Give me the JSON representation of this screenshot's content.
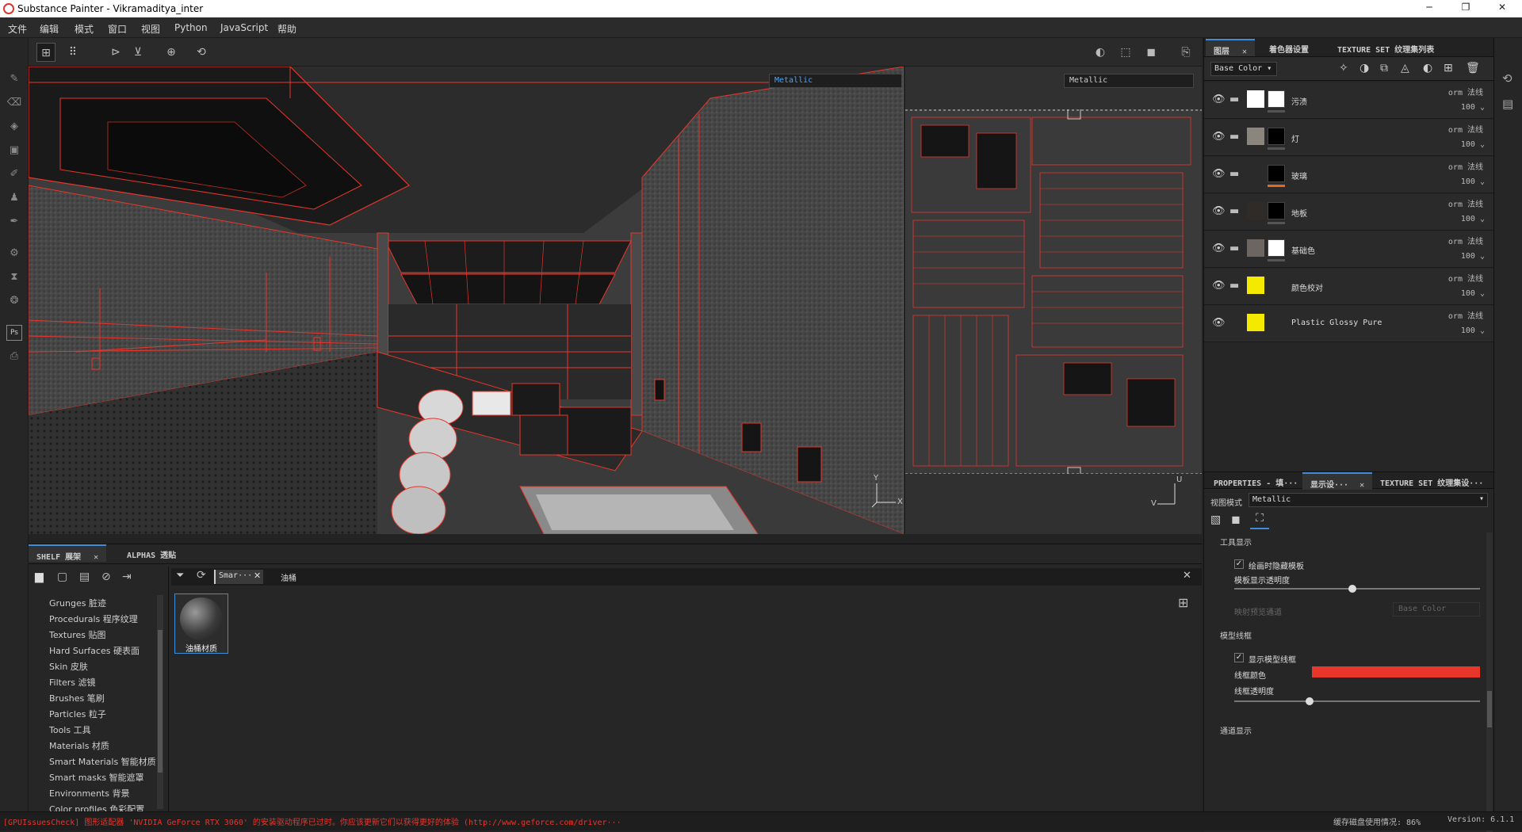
{
  "window": {
    "title": "Substance Painter - Vikramaditya_inter",
    "min_glyph": "─",
    "max_glyph": "❐",
    "close_glyph": "✕"
  },
  "menu": [
    "文件",
    "编辑",
    "模式",
    "窗口",
    "视图",
    "Python",
    "JavaScript",
    "帮助"
  ],
  "viewport": {
    "channel_3d": "Metallic",
    "channel_2d": "Metallic",
    "axis_y": "Y",
    "axis_x": "X",
    "uv_u": "U",
    "uv_v": "V"
  },
  "shelf": {
    "tabs": [
      {
        "label": "SHELF 展架",
        "active": true
      },
      {
        "label": "ALPHAS 透贴",
        "active": false
      }
    ],
    "search_chip": "Smar···",
    "search_query": "油桶",
    "categories": [
      "Grunges 脏迹",
      "Procedurals 程序纹理",
      "Textures 贴图",
      "Hard Surfaces 硬表面",
      "Skin 皮肤",
      "Filters 滤镜",
      "Brushes 笔刷",
      "Particles 粒子",
      "Tools 工具",
      "Materials 材质",
      "Smart Materials 智能材质",
      "Smart masks 智能遮罩",
      "Environments 背景",
      "Color profiles 色彩配置"
    ],
    "result_item": "油桶材质"
  },
  "layers_panel": {
    "tabs": [
      {
        "label": "图层",
        "active": true
      },
      {
        "label": "着色器设置",
        "active": false
      },
      {
        "label": "TEXTURE SET 纹理集列表",
        "active": false
      }
    ],
    "channel": "Base Color",
    "layers": [
      {
        "name": "污渍",
        "blend": "orm 法线",
        "opacity": "100",
        "thumb_color": "#ffffff",
        "mask_color": "#ffffff",
        "folder": true,
        "bar_color": "#555555"
      },
      {
        "name": "灯",
        "blend": "orm 法线",
        "opacity": "100",
        "thumb_color": "#8a857d",
        "mask_color": "#000000",
        "folder": true,
        "bar_color": "#555555"
      },
      {
        "name": "玻璃",
        "blend": "orm 法线",
        "opacity": "100",
        "thumb_color": "#2a2a2a",
        "mask_color": "#000000",
        "folder": true,
        "bar_color": "#e06a1f"
      },
      {
        "name": "地板",
        "blend": "orm 法线",
        "opacity": "100",
        "thumb_color": "#2f2b28",
        "mask_color": "#000000",
        "folder": true,
        "bar_color": "#555555"
      },
      {
        "name": "基础色",
        "blend": "orm 法线",
        "opacity": "100",
        "thumb_color": "#6d6660",
        "mask_color": "#ffffff",
        "folder": true,
        "bar_color": "#555555"
      },
      {
        "name": "颜色校对",
        "blend": "orm 法线",
        "opacity": "100",
        "thumb_color": "#f3ea00",
        "mask_color": "",
        "folder": true,
        "bar_color": ""
      },
      {
        "name": "Plastic Glossy Pure",
        "blend": "orm 法线",
        "opacity": "100",
        "thumb_color": "#f3ea00",
        "mask_color": "",
        "folder": false,
        "bar_color": ""
      }
    ]
  },
  "properties_panel": {
    "tabs": [
      {
        "label": "PROPERTIES - 填···",
        "active": false
      },
      {
        "label": "显示设···",
        "active": true
      },
      {
        "label": "TEXTURE SET 纹理集设···",
        "active": false
      }
    ],
    "view_mode_label": "视图模式",
    "view_mode_value": "Metallic",
    "section_tool": "工具显示",
    "hide_stencil_label": "绘画时隐藏模板",
    "hide_stencil_checked": true,
    "stencil_opacity_label": "模板显示透明度",
    "stencil_opacity_value": 0.48,
    "map_preview_label": "映射预览通道",
    "map_preview_value": "Base Color",
    "section_wireframe": "模型线框",
    "show_wireframe_label": "显示模型线框",
    "show_wireframe_checked": true,
    "wire_color_label": "线框颜色",
    "wire_color": "#e8362b",
    "wire_opacity_label": "线框透明度",
    "wire_opacity_value": 0.3,
    "section_channel": "通道显示"
  },
  "status": {
    "message": "[GPUIssuesCheck] 图形适配器 'NVIDIA GeForce RTX 3060' 的安装驱动程序已过时。你应该更新它们以获得更好的体验 (http://www.geforce.com/driver···",
    "cache": "缓存磁盘使用情况:  86%",
    "version": "Version: 6.1.1"
  },
  "colors": {
    "accent": "#3f8cd8",
    "wire": "#e8362b",
    "highlight_yellow": "#f3ea00"
  }
}
